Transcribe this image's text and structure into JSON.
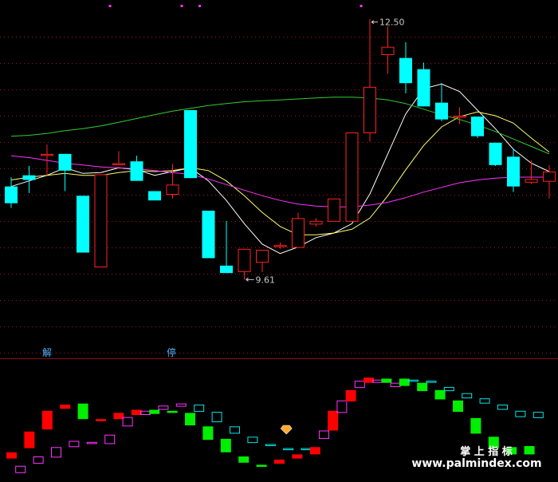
{
  "chart_data": {
    "type": "candlestick",
    "price_range": [
      9.0,
      12.6
    ],
    "candles": [
      {
        "o": 10.7,
        "h": 10.8,
        "l": 10.47,
        "c": 10.52
      },
      {
        "o": 10.82,
        "h": 10.92,
        "l": 10.63,
        "c": 10.77
      },
      {
        "o": 11.05,
        "h": 11.15,
        "l": 10.82,
        "c": 11.05
      },
      {
        "o": 11.05,
        "h": 11.05,
        "l": 10.65,
        "c": 10.87
      },
      {
        "o": 10.6,
        "h": 10.6,
        "l": 9.99,
        "c": 9.99
      },
      {
        "o": 9.84,
        "h": 10.83,
        "l": 9.84,
        "c": 10.83
      },
      {
        "o": 10.95,
        "h": 11.08,
        "l": 10.95,
        "c": 10.95
      },
      {
        "o": 10.97,
        "h": 11.03,
        "l": 10.76,
        "c": 10.76
      },
      {
        "o": 10.65,
        "h": 10.65,
        "l": 10.55,
        "c": 10.55
      },
      {
        "o": 10.62,
        "h": 10.94,
        "l": 10.57,
        "c": 10.72
      },
      {
        "o": 11.52,
        "h": 11.52,
        "l": 10.79,
        "c": 10.79
      },
      {
        "o": 10.44,
        "h": 10.44,
        "l": 9.93,
        "c": 9.93
      },
      {
        "o": 9.85,
        "h": 10.33,
        "l": 9.85,
        "c": 9.77
      },
      {
        "o": 9.79,
        "h": 10.03,
        "l": 9.7,
        "c": 10.03
      },
      {
        "o": 9.89,
        "h": 10.02,
        "l": 9.78,
        "c": 10.02
      },
      {
        "o": 10.07,
        "h": 10.1,
        "l": 10.03,
        "c": 10.07
      },
      {
        "o": 10.05,
        "h": 10.42,
        "l": 10.05,
        "c": 10.36
      },
      {
        "o": 10.3,
        "h": 10.36,
        "l": 10.27,
        "c": 10.33
      },
      {
        "o": 10.33,
        "h": 10.57,
        "l": 10.33,
        "c": 10.57
      },
      {
        "o": 10.33,
        "h": 11.28,
        "l": 10.33,
        "c": 11.28
      },
      {
        "o": 11.28,
        "h": 12.5,
        "l": 11.18,
        "c": 11.77
      },
      {
        "o": 12.12,
        "h": 12.42,
        "l": 11.91,
        "c": 12.2
      },
      {
        "o": 12.08,
        "h": 12.25,
        "l": 11.7,
        "c": 11.81
      },
      {
        "o": 11.96,
        "h": 12.03,
        "l": 11.56,
        "c": 11.56
      },
      {
        "o": 11.6,
        "h": 11.81,
        "l": 11.4,
        "c": 11.42
      },
      {
        "o": 11.46,
        "h": 11.55,
        "l": 11.37,
        "c": 11.46
      },
      {
        "o": 11.45,
        "h": 11.45,
        "l": 11.22,
        "c": 11.24
      },
      {
        "o": 11.17,
        "h": 11.17,
        "l": 10.92,
        "c": 10.93
      },
      {
        "o": 11.02,
        "h": 11.11,
        "l": 10.64,
        "c": 10.7
      },
      {
        "o": 10.75,
        "h": 10.98,
        "l": 10.73,
        "c": 10.78
      },
      {
        "o": 10.76,
        "h": 10.93,
        "l": 10.57,
        "c": 10.86
      }
    ],
    "ma_lines": [
      {
        "color": "#ffffff",
        "values": [
          10.7,
          10.76,
          10.82,
          10.9,
          10.84,
          10.85,
          10.9,
          10.88,
          10.82,
          10.86,
          10.9,
          10.76,
          10.55,
          10.3,
          10.08,
          9.98,
          10.05,
          10.15,
          10.2,
          10.3,
          10.62,
          11.05,
          11.48,
          11.75,
          11.8,
          11.72,
          11.52,
          11.32,
          11.1,
          10.95,
          10.86
        ]
      },
      {
        "color": "#ffff66",
        "values": [
          10.77,
          10.8,
          10.82,
          10.84,
          10.82,
          10.82,
          10.85,
          10.87,
          10.86,
          10.87,
          10.9,
          10.87,
          10.76,
          10.6,
          10.42,
          10.27,
          10.18,
          10.18,
          10.2,
          10.24,
          10.36,
          10.6,
          10.88,
          11.14,
          11.34,
          11.45,
          11.5,
          11.46,
          11.38,
          11.22,
          11.07
        ]
      },
      {
        "color": "#33cc33",
        "values": [
          11.24,
          11.25,
          11.27,
          11.3,
          11.32,
          11.35,
          11.39,
          11.43,
          11.47,
          11.51,
          11.54,
          11.57,
          11.59,
          11.61,
          11.62,
          11.63,
          11.64,
          11.65,
          11.66,
          11.66,
          11.65,
          11.63,
          11.59,
          11.53,
          11.47,
          11.42,
          11.36,
          11.29,
          11.21,
          11.13,
          11.05
        ]
      },
      {
        "color": "#ff33ff",
        "values": [
          11.03,
          11.01,
          10.98,
          10.95,
          10.93,
          10.91,
          10.9,
          10.89,
          10.87,
          10.85,
          10.83,
          10.78,
          10.72,
          10.66,
          10.6,
          10.55,
          10.51,
          10.49,
          10.48,
          10.48,
          10.5,
          10.53,
          10.58,
          10.64,
          10.69,
          10.74,
          10.77,
          10.79,
          10.8,
          10.8,
          10.8
        ]
      }
    ],
    "labels": {
      "high": "12.50",
      "low": "9.61"
    },
    "markers": [
      "解",
      "停"
    ],
    "indicator": [
      {
        "kind": "fill",
        "color": "#ff0000",
        "top": 0.76,
        "bot": 0.82
      },
      {
        "kind": "outline",
        "color": "#ff33ff",
        "top": 0.89,
        "bot": 0.96
      },
      {
        "kind": "fill",
        "color": "#ff0000",
        "top": 0.56,
        "bot": 0.72
      },
      {
        "kind": "outline",
        "color": "#ff33ff",
        "top": 0.8,
        "bot": 0.87
      },
      {
        "kind": "fill",
        "color": "#ff0000",
        "top": 0.36,
        "bot": 0.54
      },
      {
        "kind": "outline",
        "color": "#ff33ff",
        "top": 0.71,
        "bot": 0.81
      },
      {
        "kind": "fill",
        "color": "#ff0000",
        "top": 0.3,
        "bot": 0.34
      },
      {
        "kind": "outline",
        "color": "#ff33ff",
        "top": 0.65,
        "bot": 0.71
      },
      {
        "kind": "fill",
        "color": "#00ee00",
        "top": 0.29,
        "bot": 0.44
      },
      {
        "kind": "outline",
        "color": "#ff33ff",
        "top": 0.66,
        "bot": 0.68
      },
      {
        "kind": "fill",
        "color": "#ff0000",
        "top": 0.44,
        "bot": 0.46
      },
      {
        "kind": "outline",
        "color": "#ff33ff",
        "top": 0.59,
        "bot": 0.68
      },
      {
        "kind": "fill",
        "color": "#ff0000",
        "top": 0.38,
        "bot": 0.44
      },
      {
        "kind": "outline",
        "color": "#ff33ff",
        "top": 0.42,
        "bot": 0.51
      },
      {
        "kind": "fill",
        "color": "#ff0000",
        "top": 0.35,
        "bot": 0.4
      },
      {
        "kind": "outline",
        "color": "#ff33ff",
        "top": 0.36,
        "bot": 0.4
      },
      {
        "kind": "fill",
        "color": "#00ee00",
        "top": 0.35,
        "bot": 0.39
      },
      {
        "kind": "outline",
        "color": "#ff33ff",
        "top": 0.31,
        "bot": 0.35
      },
      {
        "kind": "fill",
        "color": "#00ee00",
        "top": 0.36,
        "bot": 0.38
      },
      {
        "kind": "outline",
        "color": "#ff33ff",
        "top": 0.29,
        "bot": 0.32
      },
      {
        "kind": "fill",
        "color": "#00ee00",
        "top": 0.38,
        "bot": 0.5
      },
      {
        "kind": "outline",
        "color": "#00e5e5",
        "top": 0.3,
        "bot": 0.37
      },
      {
        "kind": "fill",
        "color": "#00ee00",
        "top": 0.51,
        "bot": 0.64
      },
      {
        "kind": "outline",
        "color": "#00e5e5",
        "top": 0.37,
        "bot": 0.47
      },
      {
        "kind": "fill",
        "color": "#00ee00",
        "top": 0.63,
        "bot": 0.76
      },
      {
        "kind": "outline",
        "color": "#00e5e5",
        "top": 0.51,
        "bot": 0.58
      },
      {
        "kind": "fill",
        "color": "#00ee00",
        "top": 0.8,
        "bot": 0.86
      },
      {
        "kind": "outline",
        "color": "#00e5e5",
        "top": 0.61,
        "bot": 0.67
      },
      {
        "kind": "fill",
        "color": "#00ee00",
        "top": 0.88,
        "bot": 0.9
      },
      {
        "kind": "outline",
        "color": "#00e5e5",
        "top": 0.68,
        "bot": 0.7
      },
      {
        "kind": "fill",
        "color": "#ff0000",
        "top": 0.83,
        "bot": 0.87
      },
      {
        "kind": "outline",
        "color": "#00e5e5",
        "top": 0.72,
        "bot": 0.73
      },
      {
        "kind": "fill",
        "color": "#ff0000",
        "top": 0.78,
        "bot": 0.82
      },
      {
        "kind": "outline",
        "color": "#00e5e5",
        "top": 0.72,
        "bot": 0.73
      },
      {
        "kind": "fill",
        "color": "#ff0000",
        "top": 0.71,
        "bot": 0.78
      },
      {
        "kind": "outline",
        "color": "#ff33ff",
        "top": 0.55,
        "bot": 0.63
      },
      {
        "kind": "fill",
        "color": "#ff0000",
        "top": 0.36,
        "bot": 0.55
      },
      {
        "kind": "outline",
        "color": "#ff33ff",
        "top": 0.26,
        "bot": 0.38
      },
      {
        "kind": "fill",
        "color": "#ff0000",
        "top": 0.16,
        "bot": 0.27
      },
      {
        "kind": "outline",
        "color": "#ff33ff",
        "top": 0.07,
        "bot": 0.14
      },
      {
        "kind": "fill",
        "color": "#ff0000",
        "top": 0.04,
        "bot": 0.09
      },
      {
        "kind": "outline",
        "color": "#ff33ff",
        "top": 0.06,
        "bot": 0.09
      },
      {
        "kind": "fill",
        "color": "#00ee00",
        "top": 0.05,
        "bot": 0.09
      },
      {
        "kind": "outline",
        "color": "#ff33ff",
        "top": 0.09,
        "bot": 0.13
      },
      {
        "kind": "fill",
        "color": "#00ee00",
        "top": 0.05,
        "bot": 0.12
      },
      {
        "kind": "outline",
        "color": "#00e5e5",
        "top": 0.06,
        "bot": 0.08
      },
      {
        "kind": "fill",
        "color": "#00ee00",
        "top": 0.09,
        "bot": 0.17
      },
      {
        "kind": "outline",
        "color": "#00e5e5",
        "top": 0.07,
        "bot": 0.09
      },
      {
        "kind": "fill",
        "color": "#00ee00",
        "top": 0.16,
        "bot": 0.25
      },
      {
        "kind": "outline",
        "color": "#00e5e5",
        "top": 0.13,
        "bot": 0.17
      },
      {
        "kind": "fill",
        "color": "#00ee00",
        "top": 0.26,
        "bot": 0.37
      },
      {
        "kind": "outline",
        "color": "#00e5e5",
        "top": 0.19,
        "bot": 0.24
      },
      {
        "kind": "fill",
        "color": "#00ee00",
        "top": 0.43,
        "bot": 0.58
      },
      {
        "kind": "outline",
        "color": "#00e5e5",
        "top": 0.24,
        "bot": 0.29
      },
      {
        "kind": "fill",
        "color": "#00ee00",
        "top": 0.61,
        "bot": 0.72
      },
      {
        "kind": "outline",
        "color": "#00e5e5",
        "top": 0.3,
        "bot": 0.35
      },
      {
        "kind": "fill",
        "color": "#00ee00",
        "top": 0.71,
        "bot": 0.78
      },
      {
        "kind": "outline",
        "color": "#00e5e5",
        "top": 0.36,
        "bot": 0.42
      },
      {
        "kind": "fill",
        "color": "#00ee00",
        "top": 0.7,
        "bot": 0.78
      },
      {
        "kind": "outline",
        "color": "#00e5e5",
        "top": 0.37,
        "bot": 0.43
      }
    ],
    "indicator_markers": [
      {
        "kind": "diamond",
        "color": "#ffaa33",
        "at": 15
      }
    ],
    "ticks_top": [
      5,
      9,
      10,
      19
    ],
    "colors": {
      "bull": "#ff2020",
      "bear": "#00ffff",
      "grid": "#aa1111",
      "bg": "#000000"
    }
  },
  "watermark": {
    "title": "掌 上 指 标",
    "url": "www.palmindex.com"
  }
}
